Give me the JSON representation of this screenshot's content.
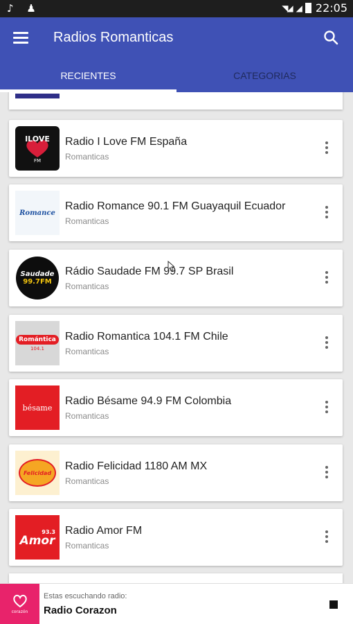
{
  "status_bar": {
    "time": "22:05"
  },
  "app_bar": {
    "title": "Radios Romanticas",
    "color": "#3f51b5",
    "tabs": [
      {
        "label": "RECIENTES",
        "selected": true
      },
      {
        "label": "CATEGORIAS",
        "selected": false
      }
    ]
  },
  "stations": [
    {
      "name": "Radio I Love FM España",
      "category": "Romanticas",
      "logo_text": "ILOVE",
      "logo_sub": "FM"
    },
    {
      "name": "Radio Romance 90.1 FM Guayaquil Ecuador",
      "category": "Romanticas",
      "logo_text": "Romance"
    },
    {
      "name": "Rádio Saudade FM 99.7 SP Brasil",
      "category": "Romanticas",
      "logo_text": "Saudade",
      "logo_sub": "99.7FM"
    },
    {
      "name": "Radio Romantica 104.1 FM Chile",
      "category": "Romanticas",
      "logo_text": "Romántica",
      "logo_sub": "104.1"
    },
    {
      "name": "Radio Bésame 94.9 FM Colombia",
      "category": "Romanticas",
      "logo_text": "bésame"
    },
    {
      "name": "Radio Felicidad 1180 AM MX",
      "category": "Romanticas",
      "logo_text": "Felicidad"
    },
    {
      "name": "Radio Amor FM",
      "category": "Romanticas",
      "logo_text": "Amor",
      "logo_sub": "93.3"
    }
  ],
  "player": {
    "label": "Estas escuchando radio:",
    "station": "Radio Corazon",
    "logo_text": "corazón",
    "color": "#e8236b"
  }
}
